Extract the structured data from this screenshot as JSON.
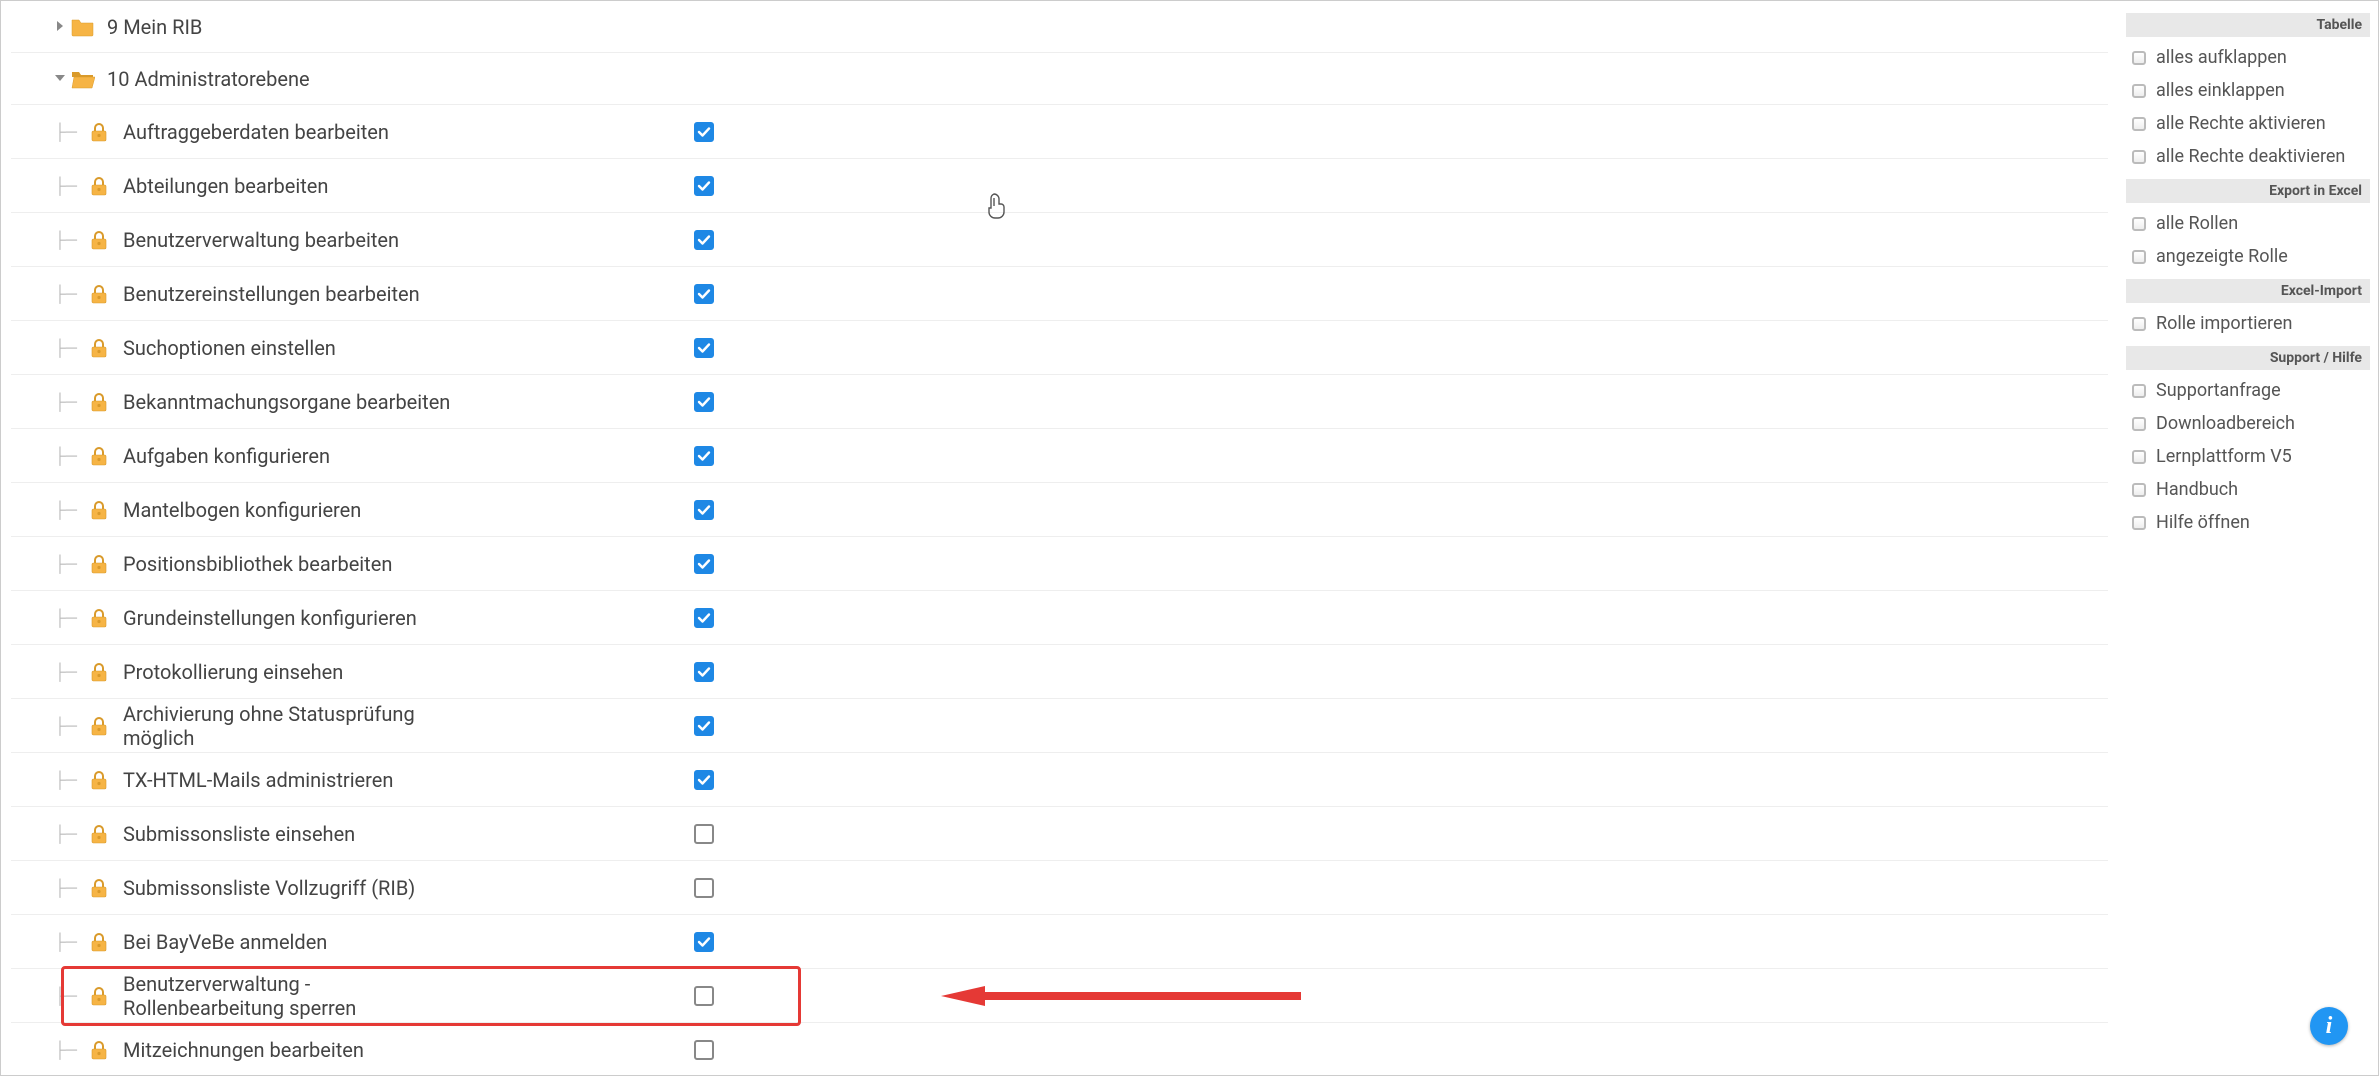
{
  "tree": {
    "folder_collapsed": {
      "label": "9 Mein RIB"
    },
    "folder_expanded": {
      "label": "10 Administratorebene"
    },
    "items": [
      {
        "label": "Auftraggeberdaten bearbeiten",
        "checked": true
      },
      {
        "label": "Abteilungen bearbeiten",
        "checked": true
      },
      {
        "label": "Benutzerverwaltung bearbeiten",
        "checked": true
      },
      {
        "label": "Benutzereinstellungen bearbeiten",
        "checked": true
      },
      {
        "label": "Suchoptionen einstellen",
        "checked": true
      },
      {
        "label": "Bekanntmachungsorgane bearbeiten",
        "checked": true
      },
      {
        "label": "Aufgaben konfigurieren",
        "checked": true
      },
      {
        "label": "Mantelbogen konfigurieren",
        "checked": true
      },
      {
        "label": "Positionsbibliothek bearbeiten",
        "checked": true
      },
      {
        "label": "Grundeinstellungen konfigurieren",
        "checked": true
      },
      {
        "label": "Protokollierung einsehen",
        "checked": true
      },
      {
        "label": "Archivierung ohne Statusprüfung möglich",
        "checked": true
      },
      {
        "label": "TX-HTML-Mails administrieren",
        "checked": true
      },
      {
        "label": "Submissonsliste einsehen",
        "checked": false
      },
      {
        "label": "Submissonsliste Vollzugriff (RIB)",
        "checked": false
      },
      {
        "label": "Bei BayVeBe anmelden",
        "checked": true
      },
      {
        "label": "Benutzerverwaltung - Rollenbearbeitung sperren",
        "checked": false,
        "highlighted": true
      },
      {
        "label": "Mitzeichnungen bearbeiten",
        "checked": false
      }
    ]
  },
  "sidebar": {
    "sections": [
      {
        "header": "Tabelle",
        "items": [
          {
            "label": "alles aufklappen"
          },
          {
            "label": "alles einklappen"
          },
          {
            "label": "alle Rechte aktivieren"
          },
          {
            "label": "alle Rechte deaktivieren"
          }
        ]
      },
      {
        "header": "Export in Excel",
        "items": [
          {
            "label": "alle Rollen"
          },
          {
            "label": "angezeigte Rolle"
          }
        ]
      },
      {
        "header": "Excel-Import",
        "items": [
          {
            "label": "Rolle importieren"
          }
        ]
      },
      {
        "header": "Support / Hilfe",
        "items": [
          {
            "label": "Supportanfrage"
          },
          {
            "label": "Downloadbereich"
          },
          {
            "label": "Lernplattform V5"
          },
          {
            "label": "Handbuch"
          },
          {
            "label": "Hilfe öffnen"
          }
        ]
      }
    ]
  },
  "info_button": {
    "glyph": "i"
  }
}
